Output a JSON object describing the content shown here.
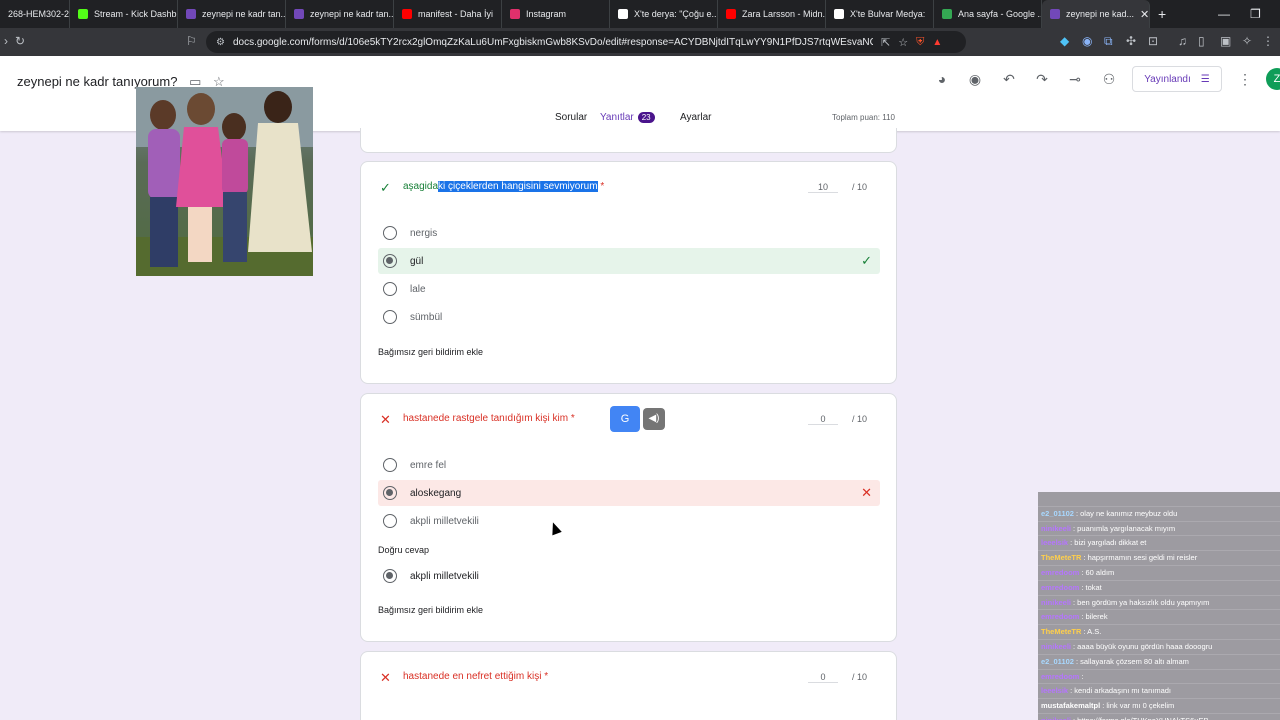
{
  "browser": {
    "tabs": [
      {
        "title": "268-HEM302-20...",
        "color": "#5f6368"
      },
      {
        "title": "Stream - Kick Dashb...",
        "color": "#53fc18"
      },
      {
        "title": "zeynepi ne kadr tan...",
        "color": "#7248b9"
      },
      {
        "title": "zeynepi ne kadr tan...",
        "color": "#7248b9"
      },
      {
        "title": "manifest - Daha İyi",
        "color": "#ff0000"
      },
      {
        "title": "Instagram",
        "color": "#e1306c"
      },
      {
        "title": "X'te derya: \"Çoğu e...",
        "color": "#ffffff"
      },
      {
        "title": "Zara Larsson - Midn...",
        "color": "#ff0000"
      },
      {
        "title": "X'te Bulvar Medya:",
        "color": "#ffffff"
      },
      {
        "title": "Ana sayfa - Google ...",
        "color": "#34a853"
      },
      {
        "title": "zeynepi ne kad...",
        "color": "#7248b9"
      }
    ],
    "url": "docs.google.com/forms/d/106e5kTY2rcx2glOmqZzKaLu6UmFxgbiskmGwb8KSvDo/edit#response=ACYDBNjtdITqLwYY9N1PfDJS7rtqWEsvaNGAzhS5-..."
  },
  "form": {
    "title": "zeynepi  ne kadr tanıyorum?",
    "publish_label": "Yayınlandı",
    "avatar_letter": "Z",
    "tabs": {
      "questions": "Sorular",
      "responses": "Yanıtlar",
      "response_count": "23",
      "settings": "Ayarlar"
    },
    "total_points": "Toplam puan: 110"
  },
  "questions": [
    {
      "title_pre": "aşagida",
      "title_highlight": "ki çiçeklerden hangisini sevmiyorum",
      "required_mark": "*",
      "score": "10",
      "max": "/ 10",
      "options": [
        "nergis",
        "gül",
        "lale",
        "sümbül"
      ],
      "feedback": "Bağımsız geri bildirim ekle"
    },
    {
      "title": "hastanede rastgele tanıdığım kişi kim",
      "required_mark": "*",
      "score": "0",
      "max": "/ 10",
      "options": [
        "emre fel",
        "aloskegang",
        "akpli milletvekili"
      ],
      "correct_label": "Doğru cevap",
      "correct_answer": "akpli milletvekili",
      "feedback": "Bağımsız geri bildirim ekle"
    },
    {
      "title": "hastanede en nefret ettiğim kişi",
      "required_mark": "*",
      "score": "0",
      "max": "/ 10"
    }
  ],
  "chat": [
    {
      "user": "",
      "msg": "",
      "color": "#c28af7"
    },
    {
      "user": "e2_01102",
      "msg": ": olay ne kanımız meybuz oldu",
      "color": "#a8d8ff"
    },
    {
      "user": "ninikeeli",
      "msg": ": puanımla yargılanacak mıyım",
      "color": "#b574ff"
    },
    {
      "user": "leeelsik",
      "msg": ": bizi yargıladı dikkat et",
      "color": "#b574ff"
    },
    {
      "user": "TheMeteTR",
      "msg": ": hapşırmamın sesi geldi mi reisler",
      "color": "#ffcf4a"
    },
    {
      "user": "emredoom",
      "msg": ": 60 aldım",
      "color": "#b574ff"
    },
    {
      "user": "emredoom",
      "msg": ": tokat",
      "color": "#b574ff"
    },
    {
      "user": "ninikeeli",
      "msg": ": ben gördüm ya haksızlık oldu yapmıyım",
      "color": "#b574ff"
    },
    {
      "user": "emredoom",
      "msg": ": bilerek",
      "color": "#b574ff"
    },
    {
      "user": "TheMeteTR",
      "msg": ": A.S.",
      "color": "#ffcf4a"
    },
    {
      "user": "ninikeeli",
      "msg": ": aaaa büyük oyunu gördün haaa dooogru",
      "color": "#b574ff"
    },
    {
      "user": "e2_01102",
      "msg": ": sallayarak çözsem 80 altı almam",
      "color": "#a8d8ff"
    },
    {
      "user": "emredoom",
      "msg": ":",
      "color": "#b574ff"
    },
    {
      "user": "leeelsik",
      "msg": ": kendi arkadaşını mı tanımadı",
      "color": "#b574ff"
    },
    {
      "user": "mustafakemaltpl",
      "msg": ": link var mı 0 çekelim",
      "color": "#ffffff"
    },
    {
      "user": "ninikeeli",
      "msg": ": https://forms.gle/THKpoYUNAkTS6uEB",
      "color": "#b574ff"
    }
  ]
}
